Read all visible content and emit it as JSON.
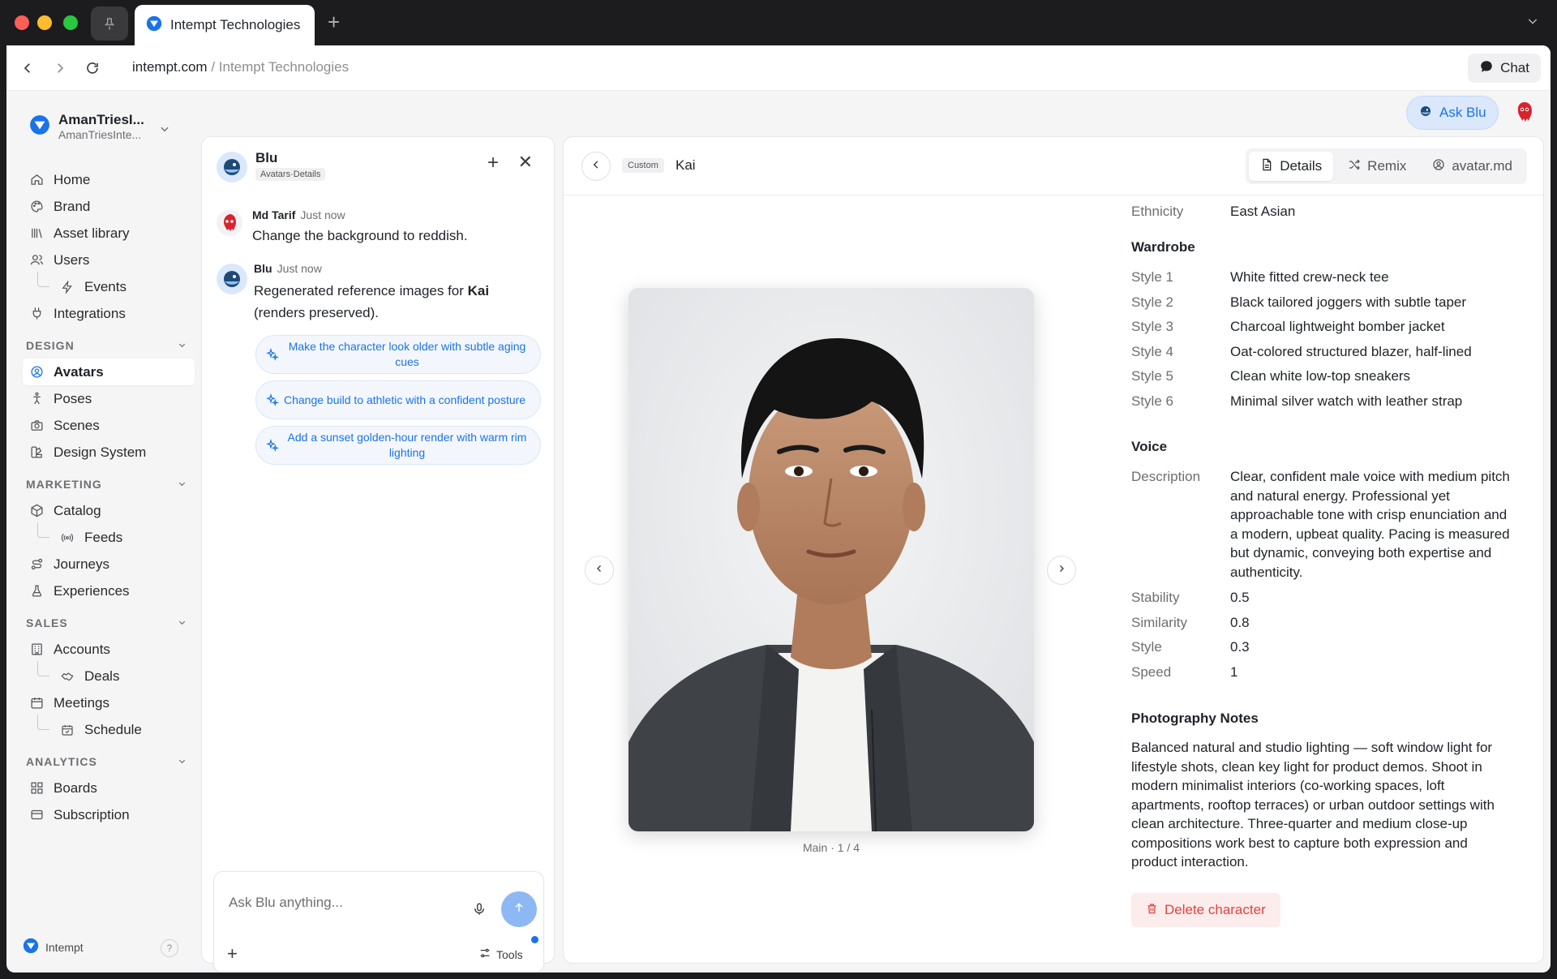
{
  "browser": {
    "tab_title": "Intempt Technologies",
    "url_domain": "intempt.com",
    "url_separator": " / ",
    "url_title": "Intempt Technologies",
    "chat_label": "Chat"
  },
  "workspace": {
    "name": "AmanTriesI...",
    "subtitle": "AmanTriesInte..."
  },
  "sidebar": {
    "main_items": [
      "Home",
      "Brand",
      "Asset library",
      "Users"
    ],
    "users_sub": "Events",
    "integrations": "Integrations",
    "design_label": "DESIGN",
    "design_items": [
      "Avatars",
      "Poses",
      "Scenes",
      "Design System"
    ],
    "marketing_label": "MARKETING",
    "catalog": "Catalog",
    "catalog_sub": "Feeds",
    "journeys": "Journeys",
    "experiences": "Experiences",
    "sales_label": "SALES",
    "accounts": "Accounts",
    "accounts_sub": "Deals",
    "meetings": "Meetings",
    "meetings_sub": "Schedule",
    "analytics_label": "ANALYTICS",
    "analytics_items": [
      "Boards",
      "Subscription"
    ],
    "footer_brand": "Intempt",
    "help": "?"
  },
  "top": {
    "ask_blu": "Ask Blu"
  },
  "chat": {
    "title": "Blu",
    "badge": "Avatars·Details",
    "messages": [
      {
        "author": "Md Tarif",
        "time": "Just now",
        "text": "Change the background to reddish."
      },
      {
        "author": "Blu",
        "time": "Just now",
        "text_before": "Regenerated reference images for ",
        "text_bold": "Kai",
        "text_after": "(renders preserved)."
      }
    ],
    "suggestions": [
      "Make the character look older with subtle aging cues",
      "Change build to athletic with a confident posture",
      "Add a sunset golden-hour render with warm rim lighting"
    ],
    "input_placeholder": "Ask Blu anything...",
    "tools_label": "Tools"
  },
  "character": {
    "tag": "Custom",
    "name": "Kai",
    "tabs": [
      "Details",
      "Remix",
      "avatar.md"
    ],
    "image_caption": "Main · 1 / 4",
    "ethnicity_label": "Ethnicity",
    "ethnicity": "East Asian",
    "wardrobe_title": "Wardrobe",
    "wardrobe": [
      {
        "k": "Style 1",
        "v": "White fitted crew-neck tee"
      },
      {
        "k": "Style 2",
        "v": "Black tailored joggers with subtle taper"
      },
      {
        "k": "Style 3",
        "v": "Charcoal lightweight bomber jacket"
      },
      {
        "k": "Style 4",
        "v": "Oat-colored structured blazer, half-lined"
      },
      {
        "k": "Style 5",
        "v": "Clean white low-top sneakers"
      },
      {
        "k": "Style 6",
        "v": "Minimal silver watch with leather strap"
      }
    ],
    "voice_title": "Voice",
    "voice_desc_label": "Description",
    "voice_desc": "Clear, confident male voice with medium pitch and natural energy. Professional yet approachable tone with crisp enunciation and a modern, upbeat quality. Pacing is measured but dynamic, conveying both expertise and authenticity.",
    "voice_params": [
      {
        "k": "Stability",
        "v": "0.5"
      },
      {
        "k": "Similarity",
        "v": "0.8"
      },
      {
        "k": "Style",
        "v": "0.3"
      },
      {
        "k": "Speed",
        "v": "1"
      }
    ],
    "photo_title": "Photography Notes",
    "photo_notes": "Balanced natural and studio lighting — soft window light for lifestyle shots, clean key light for product demos. Shoot in modern minimalist interiors (co-working spaces, loft apartments, rooftop terraces) or urban outdoor settings with clean architecture. Three-quarter and medium close-up compositions work best to capture both expression and product interaction.",
    "delete_label": "Delete character"
  },
  "colors": {
    "accent": "#1a73e8",
    "danger": "#e0443e",
    "ask_blu_bg": "#dbe8fb"
  }
}
